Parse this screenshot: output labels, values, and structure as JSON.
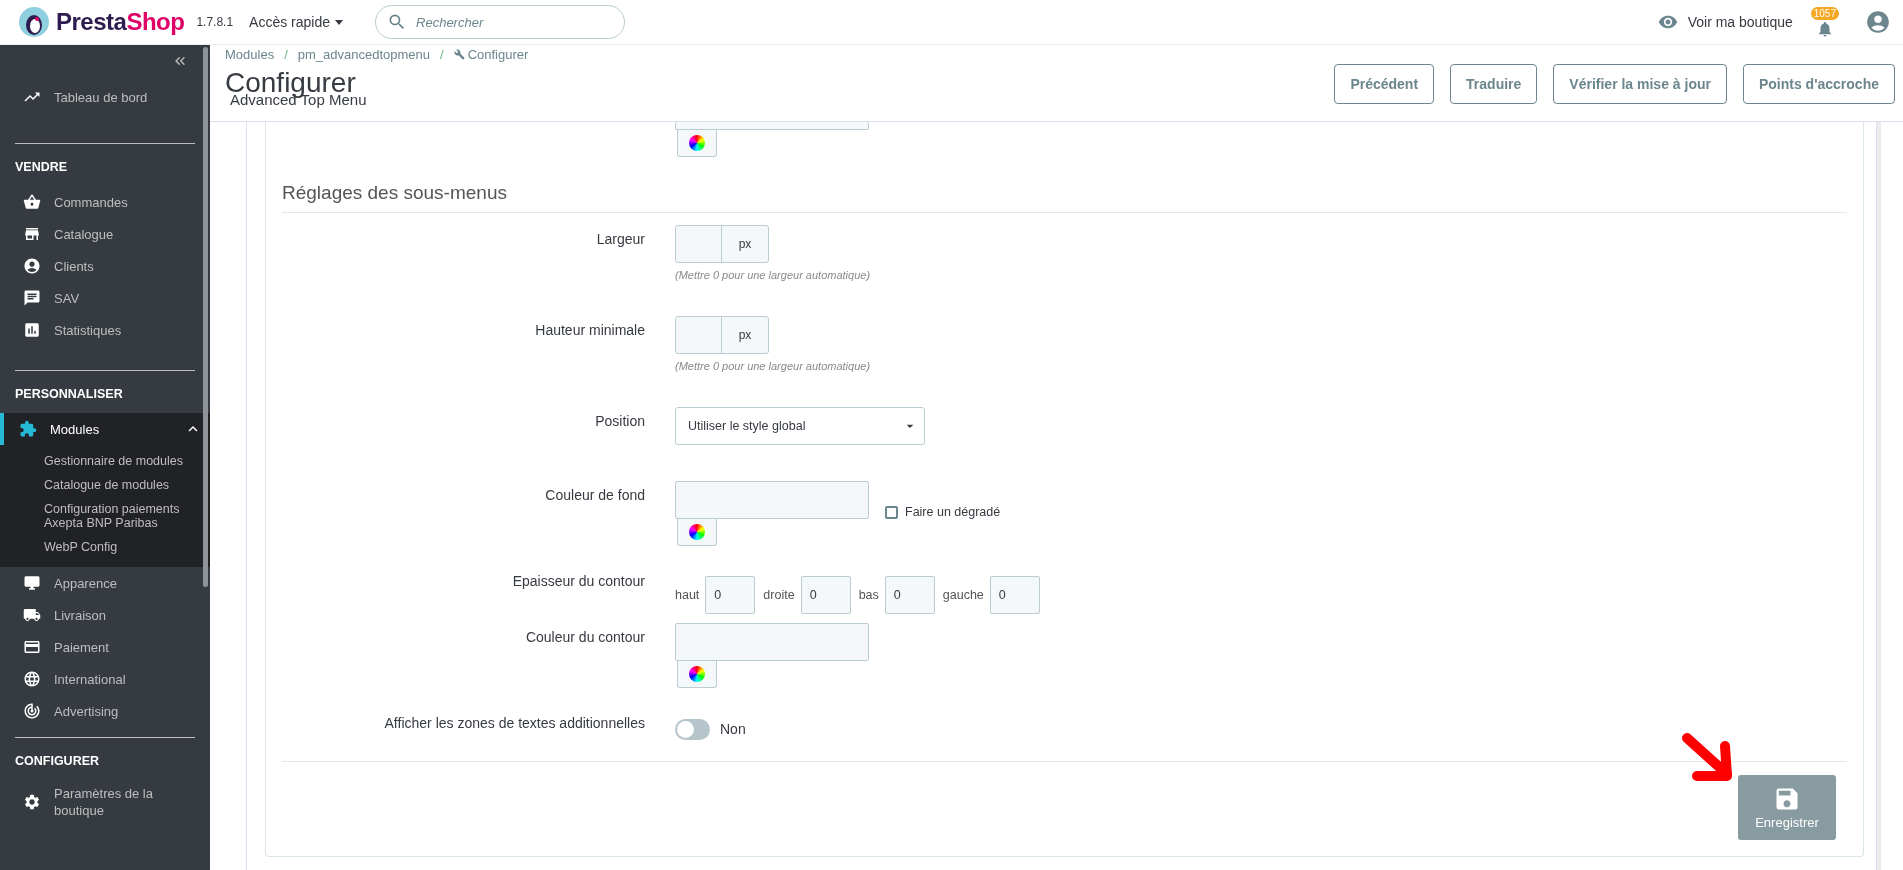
{
  "header": {
    "logo_first": "Presta",
    "logo_second": "Shop",
    "version": "1.7.8.1",
    "quick_access": "Accès rapide",
    "search": {
      "placeholder": "Rechercher"
    },
    "view_shop": "Voir ma boutique",
    "notifications": "1057"
  },
  "sidebar": {
    "dashboard": {
      "label": "Tableau de bord",
      "selected": false
    },
    "sections": [
      {
        "title": "VENDRE",
        "items": [
          {
            "label": "Commandes",
            "selected": false
          },
          {
            "label": "Catalogue",
            "selected": false
          },
          {
            "label": "Clients",
            "selected": false
          },
          {
            "label": "SAV",
            "selected": false
          },
          {
            "label": "Statistiques",
            "selected": false
          }
        ]
      },
      {
        "title": "PERSONNALISER",
        "items": [
          {
            "label": "Modules",
            "selected": true,
            "expanded": true,
            "children": [
              {
                "label": "Gestionnaire de modules",
                "selected": false
              },
              {
                "label": "Catalogue de modules",
                "selected": false
              },
              {
                "label": "Configuration paiements Axepta BNP Paribas",
                "selected": false
              },
              {
                "label": "WebP Config",
                "selected": false
              }
            ]
          },
          {
            "label": "Apparence",
            "selected": false
          },
          {
            "label": "Livraison",
            "selected": false
          },
          {
            "label": "Paiement",
            "selected": false
          },
          {
            "label": "International",
            "selected": false
          },
          {
            "label": "Advertising",
            "selected": false
          }
        ]
      },
      {
        "title": "CONFIGURER",
        "items": [
          {
            "label": "Paramètres de la boutique",
            "selected": false
          }
        ]
      }
    ]
  },
  "page": {
    "breadcrumb": [
      "Modules",
      "pm_advancedtopmenu",
      "Configurer"
    ],
    "breadcrumb_separator": "/",
    "title": "Configurer",
    "subtitle": "Advanced Top Menu",
    "toolbar": [
      "Précédent",
      "Traduire",
      "Vérifier la mise à jour",
      "Points d'accroche"
    ]
  },
  "form": {
    "section_title": "Réglages des sous-menus",
    "rows": [
      {
        "kind": "color"
      },
      {
        "kind": "heading"
      },
      {
        "kind": "unit",
        "label": "Largeur",
        "unit": "px",
        "hint": "(Mettre 0 pour une largeur automatique)"
      },
      {
        "kind": "unit",
        "label": "Hauteur minimale",
        "unit": "px",
        "hint": "(Mettre 0 pour une largeur automatique)"
      },
      {
        "kind": "select",
        "label": "Position",
        "value": "Utiliser le style global"
      },
      {
        "kind": "color",
        "label": "Couleur de fond",
        "checkbox": {
          "label": "Faire un dégradé",
          "checked": false
        }
      },
      {
        "kind": "sides",
        "label": "Epaisseur du contour",
        "sides": [
          {
            "label": "haut",
            "value": "0"
          },
          {
            "label": "droite",
            "value": "0"
          },
          {
            "label": "bas",
            "value": "0"
          },
          {
            "label": "gauche",
            "value": "0"
          }
        ]
      },
      {
        "kind": "color",
        "label": "Couleur du contour"
      },
      {
        "kind": "switch",
        "label": "Afficher les zones de textes additionnelles",
        "on": false,
        "state_label": "Non"
      }
    ],
    "save": "Enregistrer"
  }
}
